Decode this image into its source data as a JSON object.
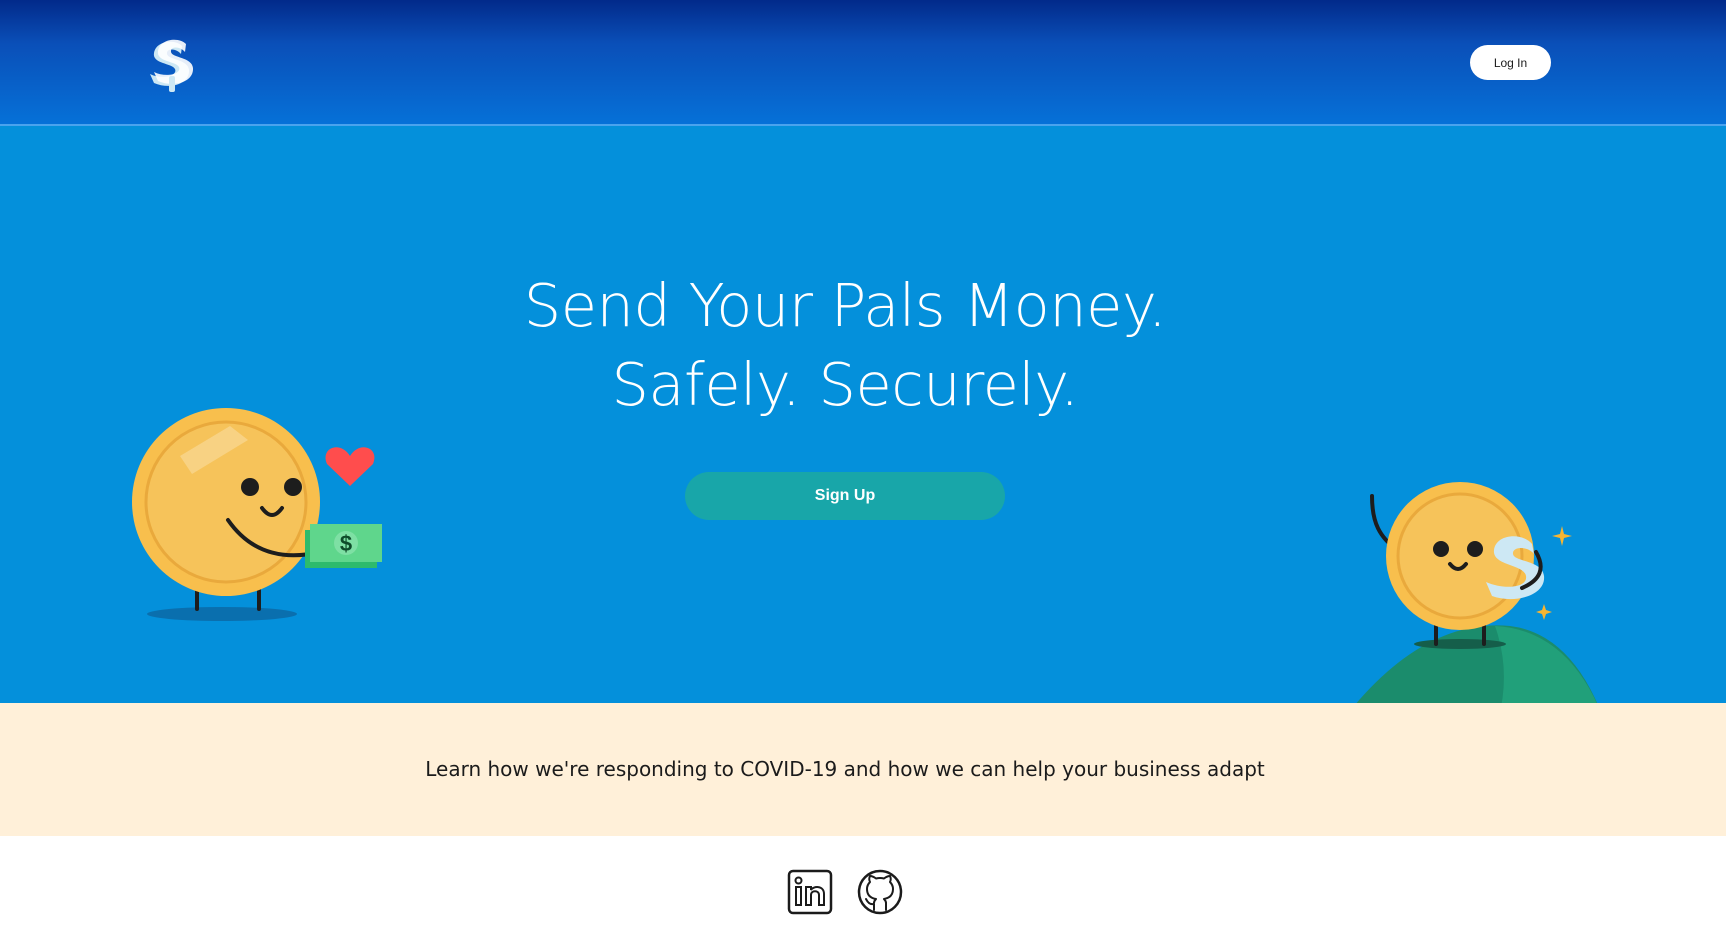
{
  "header": {
    "logo_icon": "dollar-s-logo-icon",
    "login_label": "Log In"
  },
  "hero": {
    "headline_line1": "Send Your Pals Money.",
    "headline_line2": "Safely. Securely.",
    "signup_label": "Sign Up"
  },
  "banner": {
    "text": "Learn how we're responding to COVID-19 and how we can help your business adapt"
  },
  "footer": {
    "icons": [
      "linkedin-icon",
      "github-icon"
    ]
  },
  "colors": {
    "header_top": "#022a8a",
    "header_bottom": "#0671d8",
    "hero_bg": "#0490db",
    "signup_bg": "#18a6a9",
    "banner_bg": "#fff0d9",
    "coin": "#f8bf4d",
    "hill": "#1c8f73"
  }
}
